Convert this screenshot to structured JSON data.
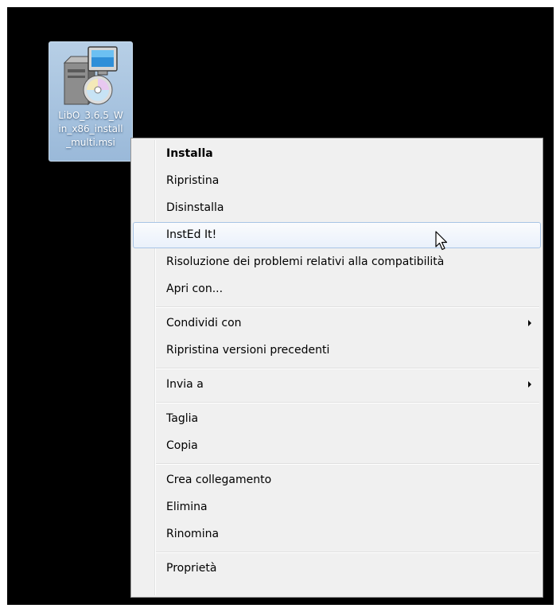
{
  "desktop": {
    "file_icon": {
      "icon": "installer-package-icon",
      "label_lines": [
        "LibO_3.6.5_W",
        "in_x86_install",
        "_multi.msi"
      ]
    }
  },
  "context_menu": {
    "items": [
      {
        "label": "Installa",
        "bold": true
      },
      {
        "label": "Ripristina"
      },
      {
        "label": "Disinstalla"
      },
      {
        "label": "InstEd It!",
        "highlighted": true
      },
      {
        "label": "Risoluzione dei problemi relativi alla compatibilità"
      },
      {
        "label": "Apri con..."
      },
      {
        "label": "Condividi con",
        "submenu": true
      },
      {
        "label": "Ripristina versioni precedenti"
      },
      {
        "label": "Invia a",
        "submenu": true
      },
      {
        "label": "Taglia"
      },
      {
        "label": "Copia"
      },
      {
        "label": "Crea collegamento"
      },
      {
        "label": "Elimina"
      },
      {
        "label": "Rinomina"
      },
      {
        "label": "Proprietà"
      }
    ]
  },
  "colors": {
    "desktop_bg": "#000000",
    "menu_bg": "#f0f0f0",
    "highlight_border": "#a8c4e5",
    "icon_selection": "#9ab9d9"
  },
  "pointer": {
    "icon": "mouse-pointer-icon"
  }
}
